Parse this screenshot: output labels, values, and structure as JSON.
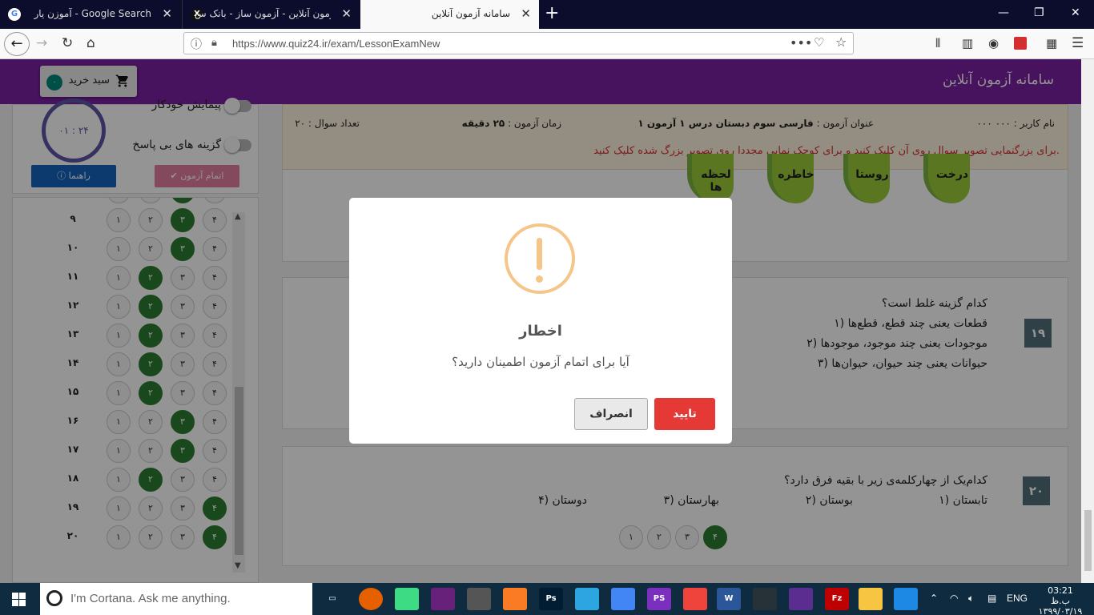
{
  "browser": {
    "tabs": [
      {
        "title": "آموزن یار - Google Search",
        "icon": "google-icon"
      },
      {
        "title": "آزمون آنلاین - آزمون ساز - بانک س",
        "icon": "x-icon"
      },
      {
        "title": "سامانه آزمون آنلاین",
        "icon": "none",
        "active": true
      }
    ],
    "new_tab": "+",
    "url": "https://www.quiz24.ir/exam/LessonExamNew"
  },
  "site": {
    "title": "سامانه آزمون آنلاین",
    "cart_label": "سبد خرید",
    "cart_count": "۰"
  },
  "panel": {
    "timer": "۰۱ : ۲۴",
    "toggle_autoplay": "پیمایش خودکار",
    "toggle_unanswered": "گزینه های بی پاسخ",
    "finish_label": "اتمام آزمون",
    "help_label": "راهنما"
  },
  "answer_sheet": [
    {
      "num": "۸",
      "opts": [
        "۱",
        "۲",
        "۳",
        "۴"
      ],
      "selected": 3
    },
    {
      "num": "۹",
      "opts": [
        "۱",
        "۲",
        "۳",
        "۴"
      ],
      "selected": 3
    },
    {
      "num": "۱۰",
      "opts": [
        "۱",
        "۲",
        "۳",
        "۴"
      ],
      "selected": 3
    },
    {
      "num": "۱۱",
      "opts": [
        "۱",
        "۲",
        "۳",
        "۴"
      ],
      "selected": 2
    },
    {
      "num": "۱۲",
      "opts": [
        "۱",
        "۲",
        "۳",
        "۴"
      ],
      "selected": 2
    },
    {
      "num": "۱۳",
      "opts": [
        "۱",
        "۲",
        "۳",
        "۴"
      ],
      "selected": 2
    },
    {
      "num": "۱۴",
      "opts": [
        "۱",
        "۲",
        "۳",
        "۴"
      ],
      "selected": 2
    },
    {
      "num": "۱۵",
      "opts": [
        "۱",
        "۲",
        "۳",
        "۴"
      ],
      "selected": 2
    },
    {
      "num": "۱۶",
      "opts": [
        "۱",
        "۲",
        "۳",
        "۴"
      ],
      "selected": 3
    },
    {
      "num": "۱۷",
      "opts": [
        "۱",
        "۲",
        "۳",
        "۴"
      ],
      "selected": 3
    },
    {
      "num": "۱۸",
      "opts": [
        "۱",
        "۲",
        "۳",
        "۴"
      ],
      "selected": 2
    },
    {
      "num": "۱۹",
      "opts": [
        "۱",
        "۲",
        "۳",
        "۴"
      ],
      "selected": 4
    },
    {
      "num": "۲۰",
      "opts": [
        "۱",
        "۲",
        "۳",
        "۴"
      ],
      "selected": 4
    }
  ],
  "exam_info": {
    "user": "نام کاربر : ۰۰۰ ۰۰۰",
    "title_label": "عنوان آزمون :",
    "title_value": "فارسی سوم دبستان درس ۱ آزمون ۱",
    "time_label": "زمان آزمون :",
    "time_value": "۲۵ دقیقه",
    "count": "تعداد سوال : ۲۰",
    "note": "برای بزرگنمایی تصویر سوال روی آن کلیک کنید و برای کوچک نمایی مجددا روی تصویر بزرگ شده کلیک کنید."
  },
  "question_image_words": [
    "درخت",
    "روستا",
    "خاطره",
    "لحظه ها"
  ],
  "questions": [
    {
      "num": "۱۹",
      "text": "کدام گزینه غلط است؟",
      "options": [
        "۱) قطعات یعنی چند قطع، قطع‌ها",
        "۲) موجودات یعنی چند موجود، موجودها",
        "۳) حیوانات یعنی چند حیوان، حیوان‌ها"
      ]
    },
    {
      "num": "۲۰",
      "text": "کدام‌یک از چهارکلمه‌ی زیر با بقیه فرق دارد؟",
      "options": [
        "۱) تابستان",
        "۲) بوستان",
        "۳) بهارستان",
        "۴) دوستان"
      ],
      "answer_opts": [
        "۴",
        "۳",
        "۲",
        "۱"
      ]
    }
  ],
  "dialog": {
    "title": "اخطار",
    "message": "آیا برای اتمام آزمون اطمینان دارید؟",
    "confirm": "تایید",
    "cancel": "انصراف"
  },
  "taskbar": {
    "cortana": "I'm Cortana. Ask me anything.",
    "lang": "ENG",
    "time": "03:21 ب.ظ",
    "date": "۱۳۹۹/۰۳/۱۹"
  },
  "colors": {
    "header": "#7b1fa2",
    "selected": "#2e7d32",
    "confirm": "#e53935",
    "warning": "#f5c589"
  }
}
